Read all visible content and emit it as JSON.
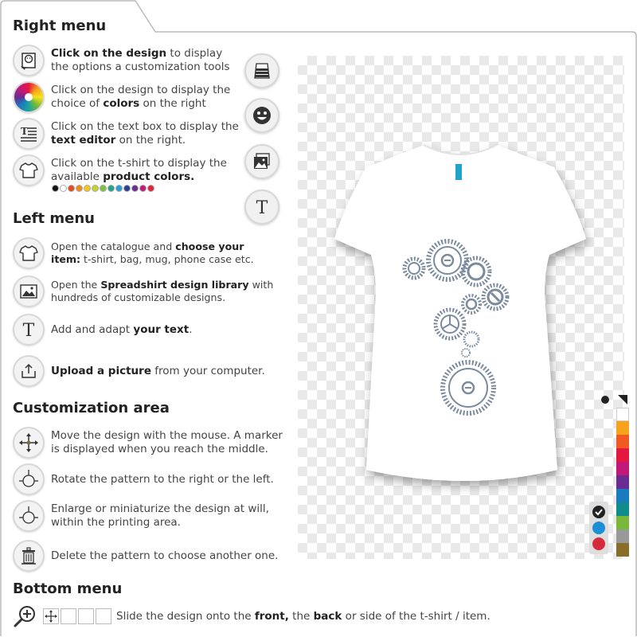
{
  "right_menu": {
    "title": "Right menu",
    "items": [
      {
        "pre": "",
        "bold": "Click on the design",
        "post": " to display the options a customization tools",
        "icon": "design-click-icon"
      },
      {
        "pre": "Click on the design to display the choice of ",
        "bold": "colors",
        "post": " on the right",
        "icon": "color-wheel-icon"
      },
      {
        "pre": "Click on the text box to display the ",
        "bold": "text editor",
        "post": " on the right.",
        "icon": "text-editor-icon"
      },
      {
        "pre": "Click on the t-shirt to display the available ",
        "bold": "product colors.",
        "post": "",
        "icon": "tshirt-icon"
      }
    ],
    "product_colors": [
      "#111111",
      "#ffffff",
      "#e34c1c",
      "#f08a1d",
      "#f5c518",
      "#c6d22a",
      "#7cc242",
      "#22a38e",
      "#2a9fd6",
      "#2d3f92",
      "#6b2c91",
      "#c2187a",
      "#e4233a"
    ]
  },
  "left_menu": {
    "title": "Left menu",
    "items": [
      {
        "pre": "Open the catalogue and ",
        "bold": "choose your item:",
        "post": " t-shirt, bag, mug, phone case etc.",
        "icon": "tshirt-icon"
      },
      {
        "pre": "Open the ",
        "bold": "Spreadshirt design library",
        "post": " with hundreds of customizable designs.",
        "icon": "image-icon"
      },
      {
        "pre": "Add and adapt ",
        "bold": "your text",
        "post": ".",
        "icon": "text-icon"
      },
      {
        "pre": "",
        "bold": "Upload a picture",
        "post": " from your computer.",
        "icon": "upload-icon"
      }
    ]
  },
  "customization": {
    "title": "Customization area",
    "items": [
      {
        "text": "Move the design with the mouse. A marker is displayed when you reach the middle.",
        "icon": "move-icon"
      },
      {
        "text": "Rotate the pattern to the right or the left.",
        "icon": "rotate-icon"
      },
      {
        "text": "Enlarge or miniaturize the design at will, within the printing area.",
        "icon": "scale-icon"
      },
      {
        "text": "Delete the pattern to choose another one.",
        "icon": "trash-icon"
      }
    ]
  },
  "bottom_menu": {
    "title": "Bottom menu",
    "pre": "Slide the design onto the ",
    "bold1": "front,",
    "mid": " the ",
    "bold2": "back",
    "post": " or side of the t-shirt / item."
  },
  "right_toolbar": [
    "tshirt-color-icon",
    "smiley-icon",
    "image-icon",
    "text-icon"
  ],
  "palette_colors": [
    "#ffffff",
    "#f7a21b",
    "#f05a22",
    "#e5173f",
    "#c2187a",
    "#6b2c91",
    "#1a7bbf",
    "#0f8c8c",
    "#7ab83b",
    "#999999",
    "#8b6d2b"
  ],
  "side_dots": [
    "#222222",
    "#1b8fd6",
    "#d42a3c"
  ],
  "brand_color": "#1fa3c9",
  "design_color": "#7b8b9d"
}
